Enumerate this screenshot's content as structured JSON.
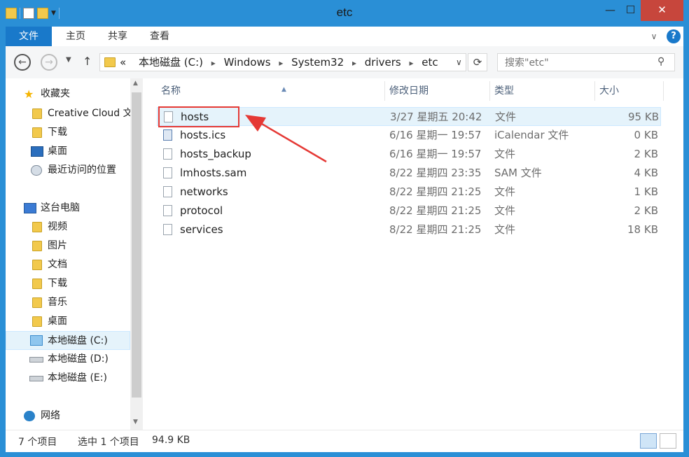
{
  "window": {
    "title": "etc"
  },
  "ribbon": {
    "tabs": [
      {
        "label": "文件"
      },
      {
        "label": "主页"
      },
      {
        "label": "共享"
      },
      {
        "label": "查看"
      }
    ],
    "help": "?"
  },
  "address": {
    "overflow": "«",
    "crumbs": [
      "本地磁盘 (C:)",
      "Windows",
      "System32",
      "drivers",
      "etc"
    ]
  },
  "search": {
    "placeholder": "搜索\"etc\""
  },
  "nav": {
    "favorites": {
      "label": "收藏夹"
    },
    "items": [
      {
        "label": "Creative Cloud 文件"
      },
      {
        "label": "下载"
      },
      {
        "label": "桌面"
      },
      {
        "label": "最近访问的位置"
      }
    ],
    "computer": {
      "label": "这台电脑"
    },
    "pc_items": [
      {
        "label": "视频"
      },
      {
        "label": "图片"
      },
      {
        "label": "文档"
      },
      {
        "label": "下载"
      },
      {
        "label": "音乐"
      },
      {
        "label": "桌面"
      },
      {
        "label": "本地磁盘 (C:)"
      },
      {
        "label": "本地磁盘 (D:)"
      },
      {
        "label": "本地磁盘 (E:)"
      }
    ],
    "network": {
      "label": "网络"
    }
  },
  "columns": {
    "name": "名称",
    "date": "修改日期",
    "type": "类型",
    "size": "大小"
  },
  "files": [
    {
      "name": "hosts",
      "date": "3/27 星期五 20:42",
      "type": "文件",
      "size": "95 KB"
    },
    {
      "name": "hosts.ics",
      "date": "6/16 星期一 19:57",
      "type": "iCalendar 文件",
      "size": "0 KB"
    },
    {
      "name": "hosts_backup",
      "date": "6/16 星期一 19:57",
      "type": "文件",
      "size": "2 KB"
    },
    {
      "name": "lmhosts.sam",
      "date": "8/22 星期四 23:35",
      "type": "SAM 文件",
      "size": "4 KB"
    },
    {
      "name": "networks",
      "date": "8/22 星期四 21:25",
      "type": "文件",
      "size": "1 KB"
    },
    {
      "name": "protocol",
      "date": "8/22 星期四 21:25",
      "type": "文件",
      "size": "2 KB"
    },
    {
      "name": "services",
      "date": "8/22 星期四 21:25",
      "type": "文件",
      "size": "18 KB"
    }
  ],
  "status": {
    "count": "7 个项目",
    "selected": "选中 1 个项目",
    "selected_size": "94.9 KB"
  },
  "colors": {
    "accent": "#2a8fd6",
    "file_tab": "#1979ca",
    "close": "#c7463c",
    "annotation": "#e53935"
  }
}
